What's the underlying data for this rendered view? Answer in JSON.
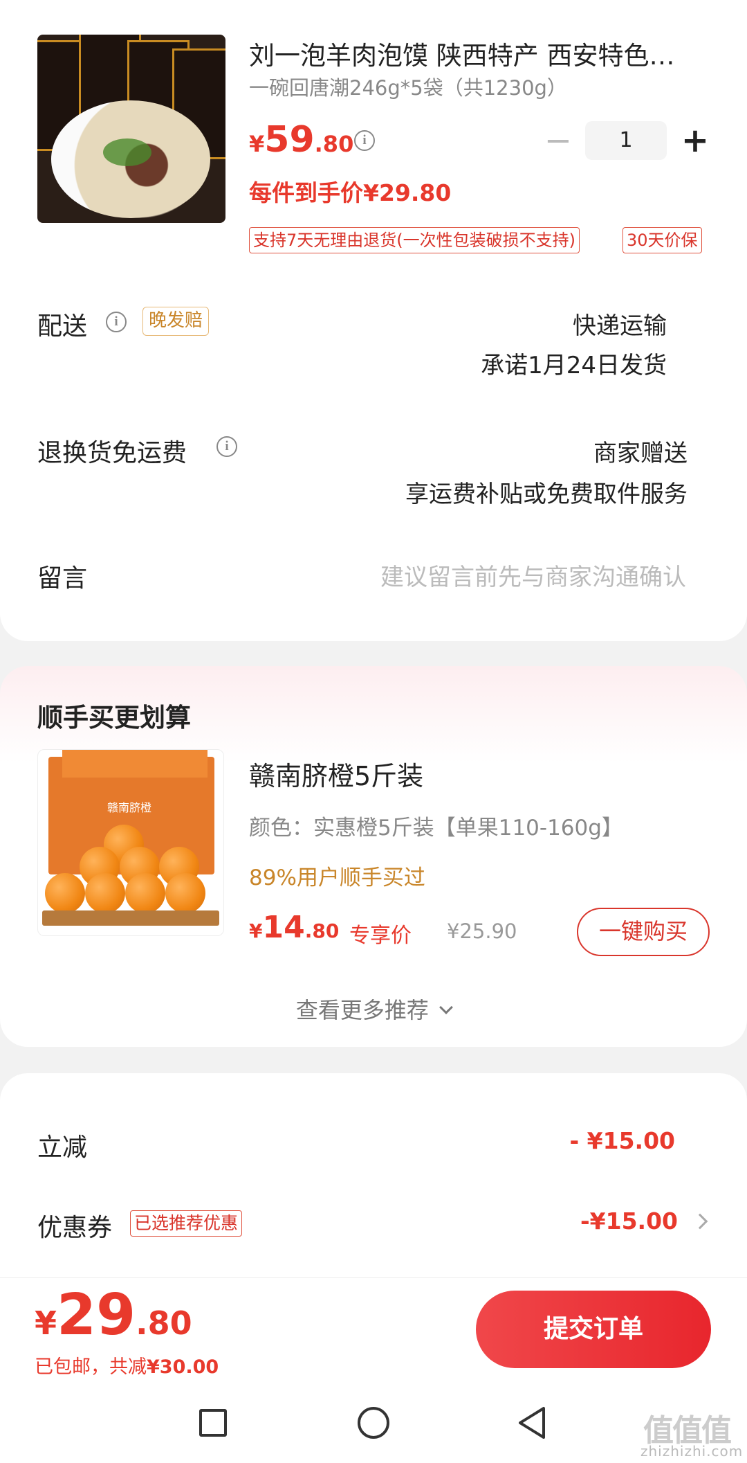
{
  "product": {
    "title": "刘一泡羊肉泡馍 陕西特产 西安特色…",
    "spec": "一碗回唐潮246g*5袋（共1230g）",
    "price_symbol": "¥",
    "price_int": "59",
    "price_dec": ".80",
    "final_price_label": "每件到手价¥29.80",
    "quantity": "1",
    "minus": "−",
    "plus": "+",
    "tags": [
      "支持7天无理由退货(一次性包装破损不支持)",
      "30天价保"
    ]
  },
  "delivery": {
    "label": "配送",
    "badge": "晚发赔",
    "method": "快递运输",
    "promise": "承诺1月24日发货"
  },
  "return_shipping": {
    "label": "退换货免运费",
    "value": "商家赠送",
    "desc": "享运费补贴或免费取件服务"
  },
  "message": {
    "label": "留言",
    "placeholder": "建议留言前先与商家沟通确认"
  },
  "addon": {
    "title": "顺手买更划算",
    "item_title": "赣南脐橙5斤装",
    "item_spec": "颜色：实惠橙5斤装【单果110-160g】",
    "social_proof": "89%用户顺手买过",
    "price_symbol": "¥",
    "price_int": "14",
    "price_dec": ".80",
    "price_tag": "专享价",
    "original_price": "¥25.90",
    "buy_button": "一键购买",
    "more": "查看更多推荐",
    "box_text": "赣南脐橙"
  },
  "summary": {
    "discount_label": "立减",
    "discount_value": "- ¥15.00",
    "coupon_label": "优惠券",
    "coupon_badge": "已选推荐优惠",
    "coupon_value": "-¥15.00"
  },
  "footer": {
    "price_symbol": "¥",
    "price_int": "29",
    "price_dec": ".80",
    "shipping_note": "已包邮，共减",
    "saved": "¥30.00",
    "submit": "提交订单"
  },
  "watermark": {
    "logo": "值值值",
    "url": "zhizhizhi.com"
  },
  "colors": {
    "accent_red": "#e8392c",
    "tag_orange": "#c9862a",
    "background": "#f2f2f2"
  }
}
